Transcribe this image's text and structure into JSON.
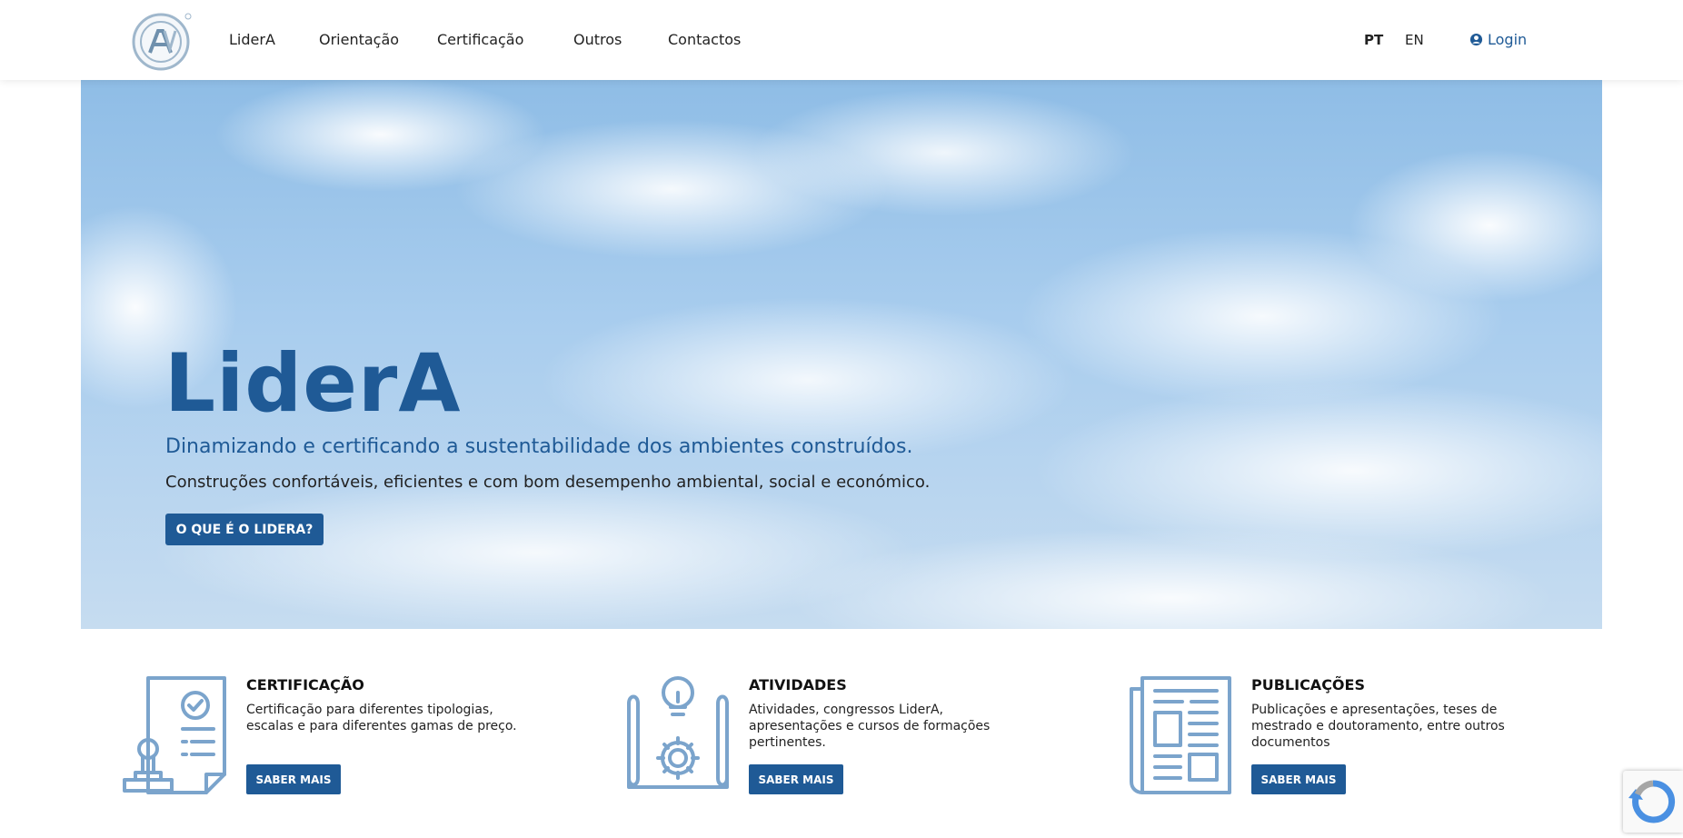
{
  "header": {
    "nav": [
      {
        "label": "LiderA"
      },
      {
        "label": "Orientação"
      },
      {
        "label": "Certificação"
      },
      {
        "label": "Outros"
      },
      {
        "label": "Contactos"
      }
    ],
    "languages": [
      "PT",
      "EN"
    ],
    "active_language": "PT",
    "login_label": "Login"
  },
  "hero": {
    "title": "LiderA",
    "subtitle": "Dinamizando e certificando a sustentabilidade dos ambientes construídos.",
    "description": "Construções confortáveis, eficientes e com bom desempenho ambiental, social e económico.",
    "button_label": "O QUE É O LIDERA?"
  },
  "features": [
    {
      "title": "CERTIFICAÇÃO",
      "description": "Certificação para diferentes tipologias, escalas e para diferentes gamas de preço.",
      "button_label": "SABER MAIS",
      "icon": "certificate-icon"
    },
    {
      "title": "ATIVIDADES",
      "description": "Atividades, congressos LiderA, apresentações e cursos de formações pertinentes.",
      "button_label": "SABER MAIS",
      "icon": "blueprint-icon"
    },
    {
      "title": "PUBLICAÇÕES",
      "description": "Publicações e apresentações, teses de mestrado e doutoramento, entre outros documentos",
      "button_label": "SABER MAIS",
      "icon": "newspaper-icon"
    }
  ],
  "colors": {
    "brand": "#1f5a96",
    "icon": "#7ba4cc"
  }
}
